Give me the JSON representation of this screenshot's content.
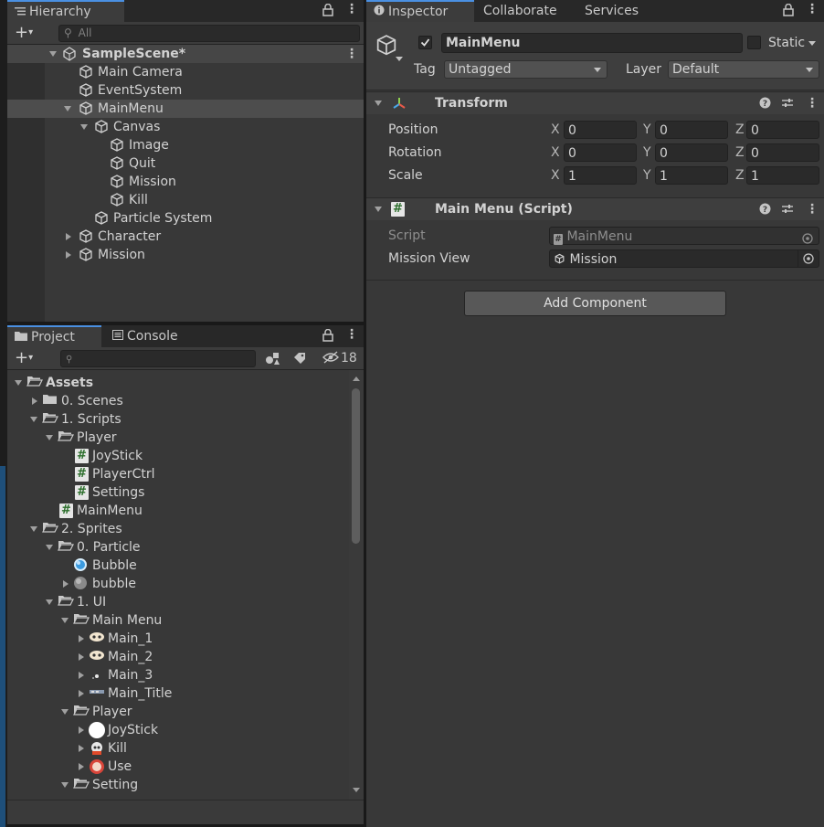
{
  "hierarchy": {
    "tab_label": "Hierarchy",
    "search_placeholder": "All",
    "scene_name": "SampleScene*",
    "items": [
      {
        "label": "Main Camera"
      },
      {
        "label": "EventSystem"
      },
      {
        "label": "MainMenu"
      },
      {
        "label": "Canvas"
      },
      {
        "label": "Image"
      },
      {
        "label": "Quit"
      },
      {
        "label": "Mission"
      },
      {
        "label": "Kill"
      },
      {
        "label": "Particle System"
      },
      {
        "label": "Character"
      },
      {
        "label": "Mission"
      }
    ]
  },
  "project": {
    "tab_project": "Project",
    "tab_console": "Console",
    "hidden_count": "18",
    "items": [
      {
        "label": "Assets"
      },
      {
        "label": "0. Scenes"
      },
      {
        "label": "1. Scripts"
      },
      {
        "label": "Player"
      },
      {
        "label": "JoyStick"
      },
      {
        "label": "PlayerCtrl"
      },
      {
        "label": "Settings"
      },
      {
        "label": "MainMenu"
      },
      {
        "label": "2. Sprites"
      },
      {
        "label": "0. Particle"
      },
      {
        "label": "Bubble"
      },
      {
        "label": "bubble"
      },
      {
        "label": "1. UI"
      },
      {
        "label": "Main Menu"
      },
      {
        "label": "Main_1"
      },
      {
        "label": "Main_2"
      },
      {
        "label": "Main_3"
      },
      {
        "label": "Main_Title"
      },
      {
        "label": "Player"
      },
      {
        "label": "JoyStick"
      },
      {
        "label": "Kill"
      },
      {
        "label": "Use"
      },
      {
        "label": "Setting"
      }
    ]
  },
  "inspector": {
    "tab_inspector": "Inspector",
    "tab_collaborate": "Collaborate",
    "tab_services": "Services",
    "object_name": "MainMenu",
    "static_label": "Static",
    "tag_label": "Tag",
    "tag_value": "Untagged",
    "layer_label": "Layer",
    "layer_value": "Default",
    "transform": {
      "title": "Transform",
      "position_label": "Position",
      "rotation_label": "Rotation",
      "scale_label": "Scale",
      "x": "X",
      "y": "Y",
      "z": "Z",
      "position": [
        "0",
        "0",
        "0"
      ],
      "rotation": [
        "0",
        "0",
        "0"
      ],
      "scale": [
        "1",
        "1",
        "1"
      ]
    },
    "script_component": {
      "title": "Main Menu (Script)",
      "script_label": "Script",
      "script_value": "MainMenu",
      "mission_view_label": "Mission View",
      "mission_view_value": "Mission"
    },
    "add_component": "Add Component"
  }
}
